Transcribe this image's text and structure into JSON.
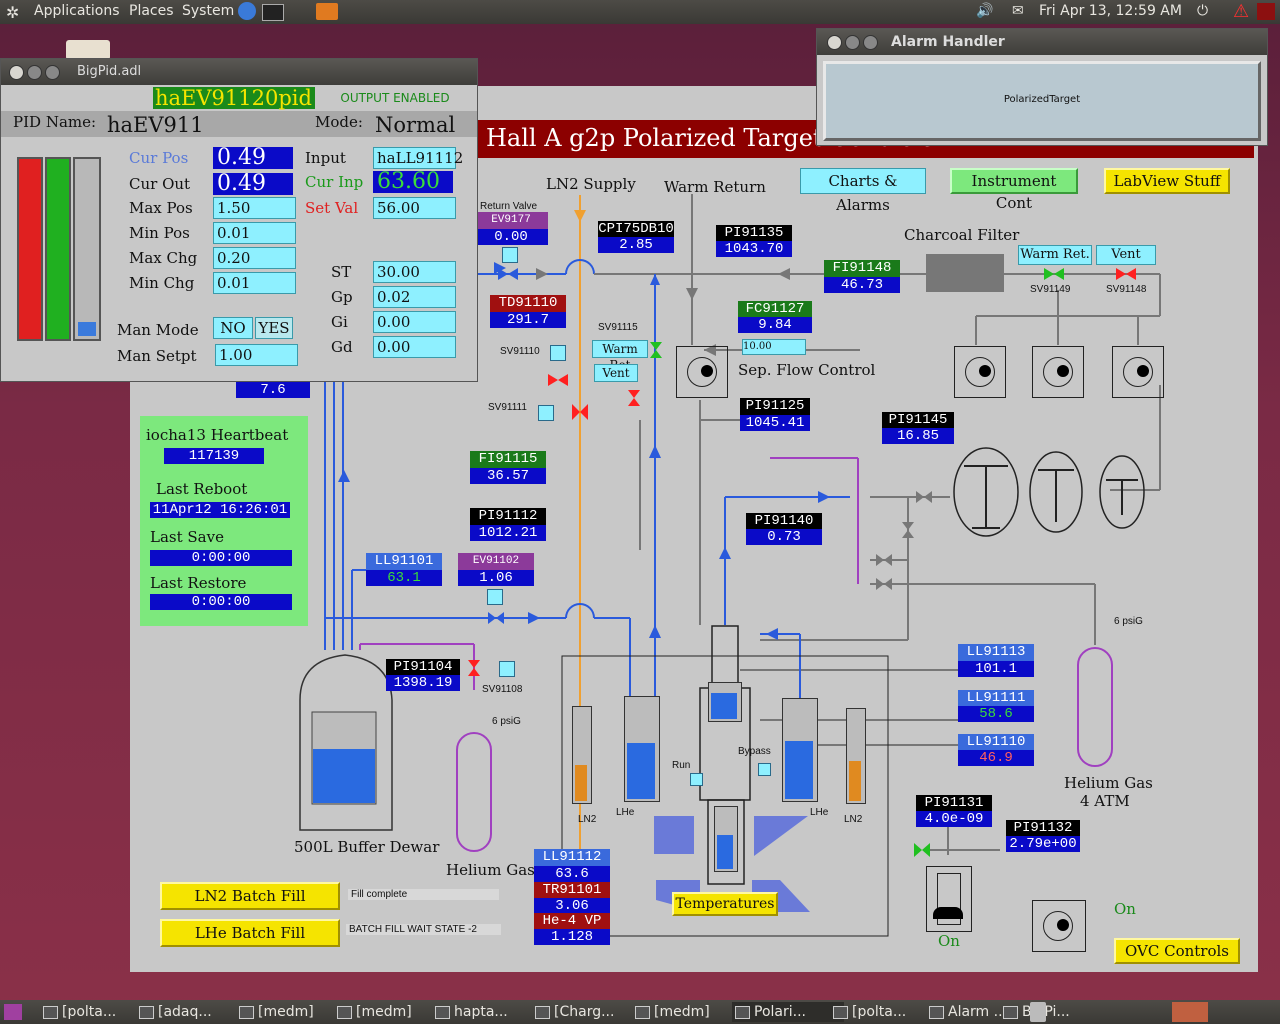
{
  "top_panel": {
    "applications": "Applications",
    "places": "Places",
    "system": "System",
    "clock": "Fri Apr 13, 12:59 AM"
  },
  "bigpid": {
    "window_title": "BigPid.adl",
    "pv_name": "haEV91120pid",
    "output_status": "OUTPUT ENABLED",
    "pid_name_label": "PID Name:",
    "pid_name": "haEV911",
    "mode_label": "Mode:",
    "mode": "Normal",
    "cur_pos_label": "Cur Pos",
    "cur_pos": "0.49",
    "cur_out_label": "Cur Out",
    "cur_out": "0.49",
    "max_pos_label": "Max Pos",
    "max_pos": "1.50",
    "min_pos_label": "Min Pos",
    "min_pos": "0.01",
    "max_chg_label": "Max Chg",
    "max_chg": "0.20",
    "min_chg_label": "Min Chg",
    "min_chg": "0.01",
    "input_label": "Input",
    "input": "haLL91112",
    "cur_inp_label": "Cur Inp",
    "cur_inp": "63.60",
    "set_val_label": "Set Val",
    "set_val": "56.00",
    "st_label": "ST",
    "st": "30.00",
    "gp_label": "Gp",
    "gp": "0.02",
    "gi_label": "Gi",
    "gi": "0.00",
    "gd_label": "Gd",
    "gd": "0.00",
    "man_mode_label": "Man Mode",
    "man_mode_no": "NO",
    "man_mode_yes": "YES",
    "man_setpt_label": "Man Setpt",
    "man_setpt": "1.00",
    "bar_gray_fill": 0.08
  },
  "alarm": {
    "window_title": "Alarm Handler",
    "group": "PolarizedTarget"
  },
  "main": {
    "title": "Hall A g2p Polarized Target Controls",
    "charts_btn": "Charts & Alarms",
    "instrument_btn": "Instrument Cont",
    "labview_btn": "LabView Stuff",
    "ln2_supply": "LN2 Supply",
    "warm_return": "Warm Return",
    "charcoal_filter": "Charcoal Filter",
    "warm_ret_btn": "Warm Ret.",
    "vent_btn": "Vent",
    "sv91149": "SV91149",
    "sv91148": "SV91148",
    "return_valve": "Return Valve",
    "ev9177_lbl": "EV9177",
    "ev9177": "0.00",
    "cpi_lbl": "CPI75DB10",
    "cpi": "2.85",
    "pi91135_lbl": "PI91135",
    "pi91135": "1043.70",
    "fi91148_lbl": "FI91148",
    "fi91148": "46.73",
    "td91110_lbl": "TD91110",
    "td91110": "291.7",
    "sv91115": "SV91115",
    "warm_ret2": "Warm Ret",
    "vent2": "Vent",
    "fc91127_lbl": "FC91127",
    "fc91127": "9.84",
    "fc_setpoint": "10.00",
    "sep_flow": "Sep. Flow Control",
    "sv91110": "SV91110",
    "sv91111": "SV91111",
    "pi91125_lbl": "PI91125",
    "pi91125": "1045.41",
    "pi91145_lbl": "PI91145",
    "pi91145": "16.85",
    "partial_val": "7.6",
    "heartbeat_label": "iocha13 Heartbeat",
    "heartbeat": "117139",
    "last_reboot_label": "Last Reboot",
    "last_reboot": "11Apr12 16:26:01",
    "last_save_label": "Last Save",
    "last_save": "0:00:00",
    "last_restore_label": "Last Restore",
    "last_restore": "0:00:00",
    "fi91115_lbl": "FI91115",
    "fi91115": "36.57",
    "pi91112_lbl": "PI91112",
    "pi91112": "1012.21",
    "pi91140_lbl": "PI91140",
    "pi91140": "0.73",
    "ll91101_lbl": "LL91101",
    "ll91101": "63.1",
    "ev91102_lbl": "EV91102",
    "ev91102": "1.06",
    "pi91104_lbl": "PI91104",
    "pi91104": "1398.19",
    "sv91108": "SV91108",
    "psig6a": "6 psiG",
    "psig6b": "6 psiG",
    "ll91113_lbl": "LL91113",
    "ll91113": "101.1",
    "ll91111_lbl": "LL91111",
    "ll91111": "58.6",
    "ll91110_lbl": "LL91110",
    "ll91110": "46.9",
    "run": "Run",
    "bypass": "Bypass",
    "ln2_a": "LN2",
    "lhe_a": "LHe",
    "lhe_b": "LHe",
    "ln2_b": "LN2",
    "buffer_dewar": "500L Buffer Dewar",
    "helium_gas": "Helium Gas",
    "helium_gas2": "Helium Gas",
    "atm4": "4 ATM",
    "pi91131_lbl": "PI91131",
    "pi91131": "4.0e-09",
    "pi91132_lbl": "PI91132",
    "pi91132": "2.79e+00",
    "ll91112_lbl": "LL91112",
    "ll91112": "63.6",
    "tr91101_lbl": "TR91101",
    "tr91101": "3.06",
    "he4vp_lbl": "He-4 VP",
    "he4vp": "1.128",
    "temperatures_btn": "Temperatures",
    "ln2_batch_btn": "LN2 Batch Fill",
    "ln2_batch_status": "Fill complete",
    "lhe_batch_btn": "LHe Batch Fill",
    "lhe_batch_status": "BATCH FILL WAIT STATE -2",
    "on1": "On",
    "on2": "On",
    "ovc_btn": "OVC Controls"
  },
  "taskbar": [
    {
      "label": "[polta..."
    },
    {
      "label": "[adaq..."
    },
    {
      "label": "[medm]"
    },
    {
      "label": "[medm]"
    },
    {
      "label": "hapta..."
    },
    {
      "label": "[Charg..."
    },
    {
      "label": "[medm]"
    },
    {
      "label": "Polari..."
    },
    {
      "label": "[polta..."
    },
    {
      "label": "Alarm ..."
    },
    {
      "label": "BigPi..."
    }
  ],
  "colors": {
    "value_bg": "#0a0ac8",
    "heartbeat_bg": "#7de87d",
    "title_bar": "#8c0000",
    "ln2_line": "#f0a030",
    "he_line": "#2a5adc",
    "purple_line": "#a040c0"
  }
}
